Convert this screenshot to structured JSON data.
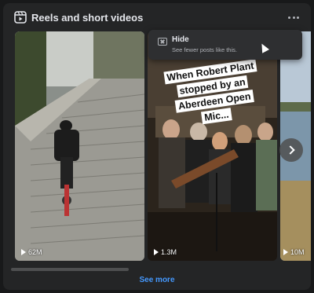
{
  "header": {
    "title": "Reels and short videos",
    "icon": "reels-icon",
    "more_icon": "more-horizontal-icon"
  },
  "menu": {
    "hide_label": "Hide",
    "hide_subtitle": "See fewer posts like this."
  },
  "reels": [
    {
      "views": "62M",
      "thumbnail": "motorcycle-on-stairs"
    },
    {
      "views": "1.3M",
      "caption": "When Robert Plant stopped by an Aberdeen Open Mic...",
      "thumbnail": "musicians-playing"
    },
    {
      "views": "10M",
      "thumbnail": "lakeside-landscape"
    }
  ],
  "see_more": "See more",
  "colors": {
    "accent": "#4599ff",
    "card": "#242526",
    "page": "#18191a"
  }
}
